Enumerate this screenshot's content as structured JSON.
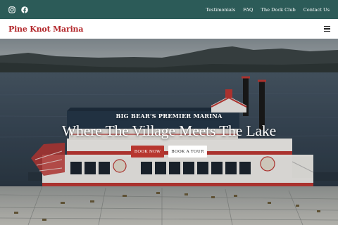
{
  "topbar": {
    "social": [
      {
        "icon": "instagram-icon"
      },
      {
        "icon": "facebook-icon"
      }
    ],
    "links": [
      "Testimonials",
      "FAQ",
      "The Dock Club",
      "Contact Us"
    ]
  },
  "header": {
    "logo": "Pine Knot Marina",
    "menu_icon": "hamburger-menu-icon"
  },
  "hero": {
    "kicker": "BIG BEAR'S PREMIER MARINA",
    "headline": "Where The Village Meets The Lake",
    "buttons": {
      "book_now": "BOOK NOW",
      "book_tour": "BOOK A TOUR"
    }
  },
  "colors": {
    "topbar": "#2c5b58",
    "brand_red": "#b3272b",
    "button_red": "#b7362f"
  }
}
